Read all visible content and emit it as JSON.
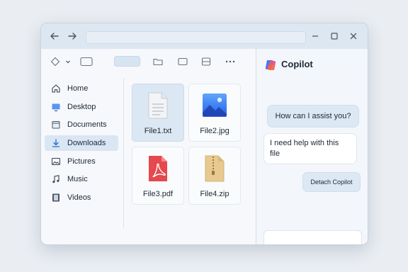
{
  "sidebar": {
    "items": [
      {
        "label": "Home",
        "icon": "home-icon",
        "active": false
      },
      {
        "label": "Desktop",
        "icon": "desktop-icon",
        "active": false
      },
      {
        "label": "Documents",
        "icon": "documents-icon",
        "active": false
      },
      {
        "label": "Downloads",
        "icon": "downloads-icon",
        "active": true
      },
      {
        "label": "Pictures",
        "icon": "pictures-icon",
        "active": false
      },
      {
        "label": "Music",
        "icon": "music-icon",
        "active": false
      },
      {
        "label": "Videos",
        "icon": "videos-icon",
        "active": false
      }
    ]
  },
  "files": [
    {
      "name": "File1.txt",
      "icon": "text-file-icon",
      "selected": true
    },
    {
      "name": "File2.jpg",
      "icon": "image-file-icon",
      "selected": false
    },
    {
      "name": "File3.pdf",
      "icon": "pdf-file-icon",
      "selected": false
    },
    {
      "name": "File4.zip",
      "icon": "zip-file-icon",
      "selected": false
    }
  ],
  "copilot": {
    "title": "Copilot",
    "messages": [
      {
        "role": "user",
        "text": "How can I assist you?"
      },
      {
        "role": "assistant",
        "text": "I need help with this file"
      }
    ],
    "detach_label": "Detach Copilot",
    "input_placeholder": ""
  },
  "colors": {
    "accent": "#1f6fc5",
    "selection": "#d9e6f3",
    "pdf_red": "#e5484d",
    "image_blue": "#3b82f6",
    "zip_tan": "#e8c98f"
  }
}
